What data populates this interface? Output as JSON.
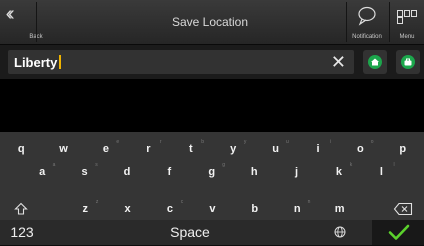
{
  "header": {
    "back_label": "Back",
    "title": "Save Location",
    "notification_label": "Notification",
    "menu_label": "Menu"
  },
  "search": {
    "value": "Liberty",
    "clear_icon": "close-icon",
    "home_icon": "home-icon",
    "work_icon": "briefcase-icon"
  },
  "keyboard": {
    "row1": [
      {
        "label": "q",
        "hint": ""
      },
      {
        "label": "w",
        "hint": ""
      },
      {
        "label": "e",
        "hint": "e"
      },
      {
        "label": "r",
        "hint": "r"
      },
      {
        "label": "t",
        "hint": "b"
      },
      {
        "label": "y",
        "hint": "y"
      },
      {
        "label": "u",
        "hint": "u"
      },
      {
        "label": "i",
        "hint": "i"
      },
      {
        "label": "o",
        "hint": "o"
      },
      {
        "label": "p",
        "hint": ""
      }
    ],
    "row2": [
      {
        "label": "a",
        "hint": "a"
      },
      {
        "label": "s",
        "hint": "s"
      },
      {
        "label": "d",
        "hint": ""
      },
      {
        "label": "f",
        "hint": ""
      },
      {
        "label": "g",
        "hint": "g"
      },
      {
        "label": "h",
        "hint": ""
      },
      {
        "label": "j",
        "hint": ""
      },
      {
        "label": "k",
        "hint": "k"
      },
      {
        "label": "l",
        "hint": "l"
      }
    ],
    "row3": [
      {
        "label": "z",
        "hint": "z"
      },
      {
        "label": "x",
        "hint": ""
      },
      {
        "label": "c",
        "hint": "c"
      },
      {
        "label": "v",
        "hint": ""
      },
      {
        "label": "b",
        "hint": ""
      },
      {
        "label": "n",
        "hint": "n"
      },
      {
        "label": "m",
        "hint": ""
      }
    ],
    "shift_icon": "shift-icon",
    "backspace_icon": "backspace-icon",
    "numbers_label": "123",
    "space_label": "Space",
    "globe_icon": "globe-icon",
    "done_icon": "checkmark-icon"
  },
  "colors": {
    "accent_green": "#1ca64c",
    "cursor": "#f0b400",
    "checkmark": "#5bd12c"
  }
}
